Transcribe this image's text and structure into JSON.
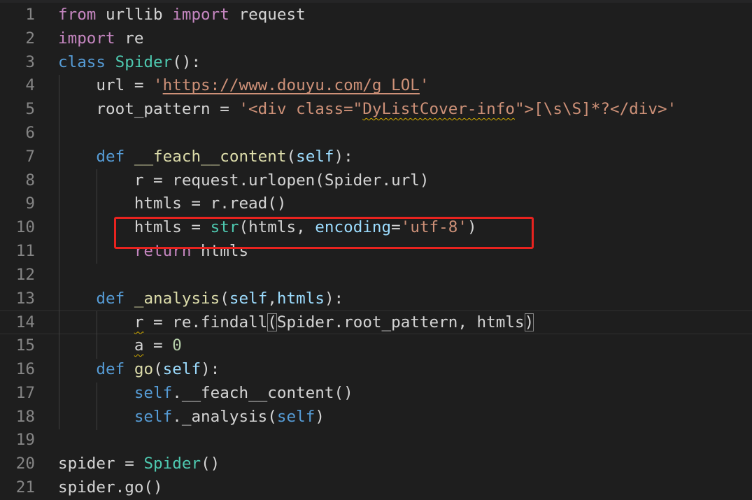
{
  "editor": {
    "lines": [
      [
        [
          "from",
          "k"
        ],
        [
          " urllib ",
          ""
        ],
        [
          "import",
          "k"
        ],
        [
          " request",
          ""
        ]
      ],
      [
        [
          "import",
          "k"
        ],
        [
          " re",
          ""
        ]
      ],
      [
        [
          "class",
          "d"
        ],
        [
          " ",
          ""
        ],
        [
          "Spider",
          "t"
        ],
        [
          "():",
          ""
        ]
      ],
      [
        [
          "    url = ",
          ""
        ],
        [
          "'",
          "s"
        ],
        [
          "https://www.douyu.com/g_LOL",
          "s link"
        ],
        [
          "'",
          "s"
        ]
      ],
      [
        [
          "    root_pattern = ",
          ""
        ],
        [
          "'<div class=\"",
          "s"
        ],
        [
          "DyListCover-info",
          "s sq"
        ],
        [
          "\">[\\s\\S]*?</div>'",
          "s"
        ]
      ],
      [],
      [
        [
          "    ",
          ""
        ],
        [
          "def",
          "d"
        ],
        [
          " ",
          ""
        ],
        [
          "__feach__content",
          "f"
        ],
        [
          "(",
          ""
        ],
        [
          "self",
          "v"
        ],
        [
          "):",
          ""
        ]
      ],
      [
        [
          "        r = request.urlopen(Spider.url)",
          ""
        ]
      ],
      [
        [
          "        htmls = r.read()",
          ""
        ]
      ],
      [
        [
          "        htmls = ",
          ""
        ],
        [
          "str",
          "t"
        ],
        [
          "(htmls, ",
          ""
        ],
        [
          "encoding",
          "v"
        ],
        [
          "=",
          ""
        ],
        [
          "'utf-8'",
          "s"
        ],
        [
          ")",
          ""
        ]
      ],
      [
        [
          "        ",
          ""
        ],
        [
          "return",
          "k"
        ],
        [
          " htmls",
          ""
        ]
      ],
      [],
      [
        [
          "    ",
          ""
        ],
        [
          "def",
          "d"
        ],
        [
          " ",
          ""
        ],
        [
          "_analysis",
          "f"
        ],
        [
          "(",
          ""
        ],
        [
          "self",
          "v"
        ],
        [
          ",",
          ""
        ],
        [
          "htmls",
          "v"
        ],
        [
          "):",
          ""
        ]
      ],
      [
        [
          "        ",
          ""
        ],
        [
          "r",
          "sq"
        ],
        [
          " = re.findall",
          ""
        ],
        [
          "(",
          "br"
        ],
        [
          "Spider.root_pattern, htmls",
          ""
        ],
        [
          ")",
          "br"
        ]
      ],
      [
        [
          "        ",
          ""
        ],
        [
          "a",
          "sq"
        ],
        [
          " = ",
          ""
        ],
        [
          "0",
          "n"
        ]
      ],
      [
        [
          "    ",
          ""
        ],
        [
          "def",
          "d"
        ],
        [
          " ",
          ""
        ],
        [
          "go",
          "f"
        ],
        [
          "(",
          ""
        ],
        [
          "self",
          "v"
        ],
        [
          "):",
          ""
        ]
      ],
      [
        [
          "        ",
          ""
        ],
        [
          "self",
          "d"
        ],
        [
          ".__feach__content()",
          ""
        ]
      ],
      [
        [
          "        ",
          ""
        ],
        [
          "self",
          "d"
        ],
        [
          "._analysis(",
          ""
        ],
        [
          "self",
          "d"
        ],
        [
          ")",
          ""
        ]
      ],
      [],
      [
        [
          "spider = ",
          ""
        ],
        [
          "Spider",
          "t"
        ],
        [
          "()",
          ""
        ]
      ],
      [
        [
          "spider.go()",
          ""
        ]
      ]
    ],
    "current_line": 14
  },
  "colors": {
    "background": "#1e1e1e",
    "highlight_box": "#e8231f"
  }
}
